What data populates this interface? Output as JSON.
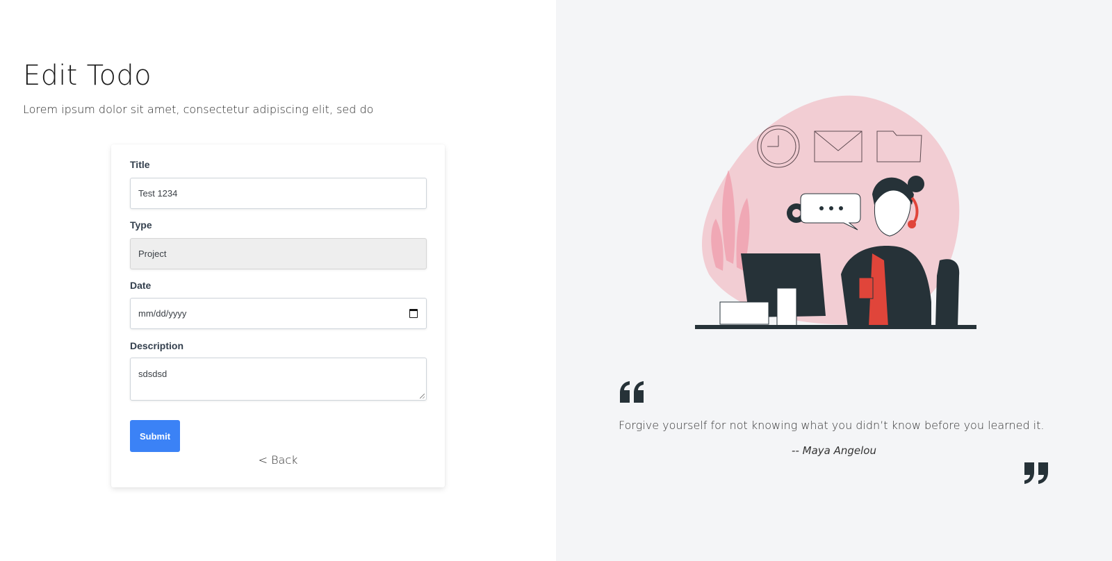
{
  "header": {
    "title": "Edit Todo",
    "subtitle": "Lorem ipsum dolor sit amet, consectetur adipiscing elit, sed do"
  },
  "form": {
    "title": {
      "label": "Title",
      "value": "Test 1234"
    },
    "type": {
      "label": "Type",
      "value": "Project"
    },
    "date": {
      "label": "Date",
      "placeholder": "mm/dd/yyyy",
      "icon": "calendar-icon"
    },
    "description": {
      "label": "Description",
      "value": "sdsdsd"
    },
    "submit_label": "Submit",
    "back_label": "< Back"
  },
  "quote": {
    "text": "Forgive yourself for not knowing what you didn’t know before you learned it.",
    "author": "-- Maya Angelou"
  },
  "colors": {
    "accent": "#3b82f6",
    "right_pane_bg": "#f4f5f7",
    "illustration_blob": "#f2cdd3",
    "illustration_dark": "#263238",
    "illustration_red": "#e0453a"
  }
}
